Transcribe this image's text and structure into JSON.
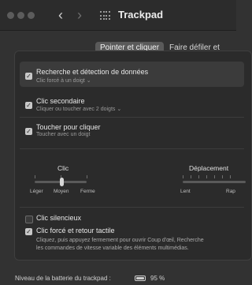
{
  "window": {
    "title": "Trackpad",
    "back_glyph": "‹",
    "forward_glyph": "›"
  },
  "tabs": [
    {
      "label": "Pointer et cliquer",
      "active": true
    },
    {
      "label": "Faire défiler et zoom",
      "active": false
    }
  ],
  "options": {
    "lookup": {
      "label": "Recherche et détection de données",
      "sub": "Clic forcé à un doigt ⌄",
      "checked": true
    },
    "secondary": {
      "label": "Clic secondaire",
      "sub": "Cliquer ou toucher avec 2 doigts ⌄",
      "checked": true
    },
    "tap": {
      "label": "Toucher pour cliquer",
      "sub": "Toucher avec un doigt",
      "checked": true
    }
  },
  "sliders": {
    "click": {
      "title": "Clic",
      "labels": [
        "Léger",
        "Moyen",
        "Ferme"
      ],
      "level": "Moyen"
    },
    "tracking": {
      "title": "Déplacement",
      "labels": [
        "Lent",
        "Rap"
      ]
    }
  },
  "silent_click": {
    "label": "Clic silencieux",
    "checked": false
  },
  "force_click": {
    "label": "Clic forcé et retour tactile",
    "checked": true,
    "description_line1": "Cliquez, puis appuyez fermement pour ouvrir Coup d'œil, Recherche",
    "description_line2": "les commandes de vitesse variable des éléments multimédias."
  },
  "battery": {
    "label": "Niveau de la batterie du trackpad :",
    "percent": "95 %",
    "level": 0.95
  },
  "checkmark": "✓",
  "colors": {
    "background": "#323232",
    "pane": "#2b2b2b",
    "highlight": "#3b3b3b"
  }
}
